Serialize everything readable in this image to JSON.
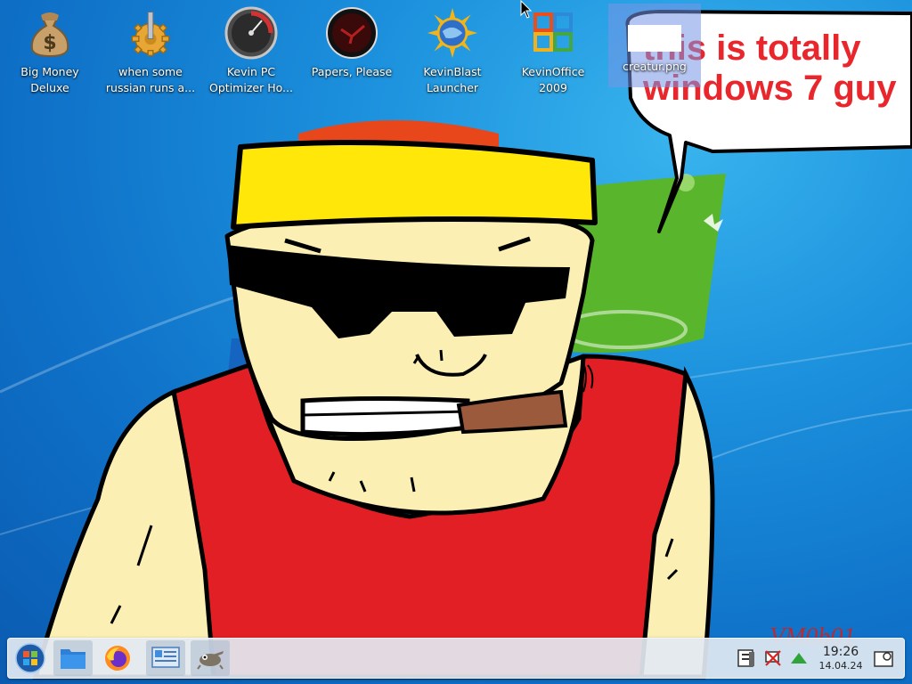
{
  "desktop": {
    "icons": [
      {
        "label": "Big Money\nDeluxe",
        "icon": "money-bag-icon"
      },
      {
        "label": "when some\nrussian runs a...",
        "icon": "gear-icon"
      },
      {
        "label": "Kevin PC\nOptimizer Ho...",
        "icon": "speedometer-icon"
      },
      {
        "label": "Papers, Please",
        "icon": "papers-please-icon"
      },
      {
        "label": "KevinBlast\nLauncher",
        "icon": "globe-sun-icon"
      },
      {
        "label": "KevinOffice\n2009",
        "icon": "office-logo-icon"
      },
      {
        "label": "creatur.png",
        "icon": "image-file-icon",
        "selected": true
      }
    ]
  },
  "wallpaper": {
    "speech_bubble_text": "this is totally\nwindows 7 guy",
    "watermark": "VM0b01"
  },
  "taskbar": {
    "launchers": [
      {
        "name": "start-menu-button",
        "icon": "start-orb-icon"
      },
      {
        "name": "file-manager-button",
        "icon": "folder-icon"
      },
      {
        "name": "firefox-button",
        "icon": "firefox-icon"
      },
      {
        "name": "control-panel-button",
        "icon": "control-panel-icon"
      },
      {
        "name": "gimp-button",
        "icon": "gimp-icon"
      }
    ],
    "tray": {
      "icons": [
        "clipboard-icon",
        "network-disconnected-icon",
        "updates-arrow-icon"
      ],
      "time": "19:26",
      "date": "14.04.24",
      "show_desktop_icon": "show-desktop-icon"
    }
  },
  "colors": {
    "desktop_bg": "#1b8fdc",
    "taskbar_bg": "#e2e9f2",
    "speech_text": "#e8262b"
  }
}
